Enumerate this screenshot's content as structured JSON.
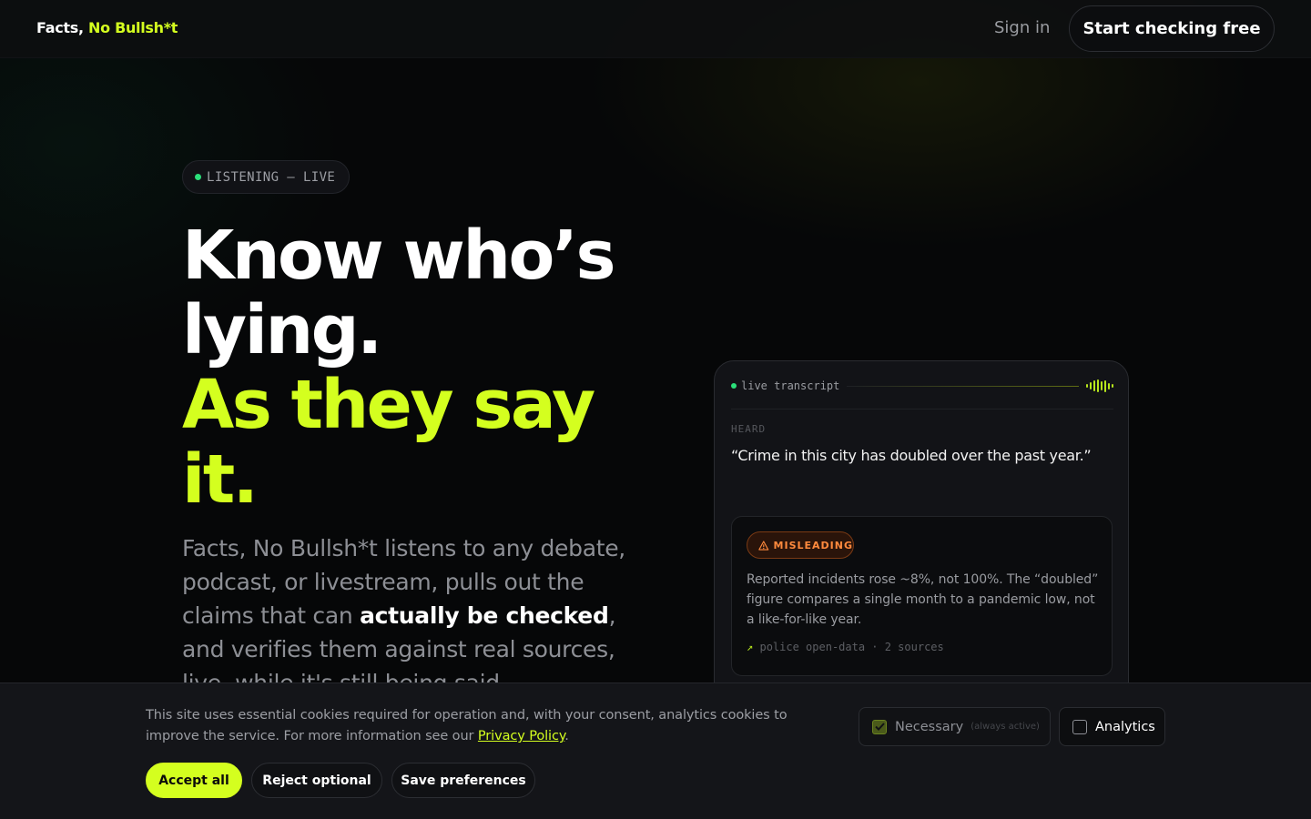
{
  "header": {
    "logo_main": "Facts,",
    "logo_accent": "No Bullsh*t",
    "signin_label": "Sign in",
    "cta_label": "Start checking free"
  },
  "hero": {
    "status_pill": "LISTENING — LIVE",
    "headline_line1": "Know who’s",
    "headline_line2": "lying.",
    "headline_line3": "As they say",
    "headline_line4": "it.",
    "desc_before": "Facts, No Bullsh*t listens to any debate, podcast, or livestream, pulls out the claims that can ",
    "desc_strong": "actually be checked",
    "desc_after": ", and verifies them against real sources, live, while it's still being said."
  },
  "transcript_card": {
    "label": "live transcript",
    "heard_label": "HEARD",
    "quote": "“Crime in this city has doubled over the past year.”",
    "verdict": {
      "badge": "MISLEADING",
      "text": "Reported incidents rose ~8%, not 100%. The “doubled” figure compares a single month to a pandemic low, not a like-for-like year.",
      "sources_arrow": "↗",
      "sources": "police open-data · 2 sources"
    }
  },
  "cookie_banner": {
    "text_before": "This site uses essential cookies required for operation and, with your consent, analytics cookies to improve the service. For more information see our ",
    "privacy_link": "Privacy Policy",
    "text_after": ".",
    "necessary_label": "Necessary",
    "necessary_note": "(always active)",
    "analytics_label": "Analytics",
    "accept_label": "Accept all",
    "reject_label": "Reject optional",
    "save_label": "Save preferences"
  },
  "colors": {
    "accent": "#d4ff1f",
    "live_dot": "#2be07a",
    "misleading": "#ff8a3d",
    "background": "#060708"
  }
}
